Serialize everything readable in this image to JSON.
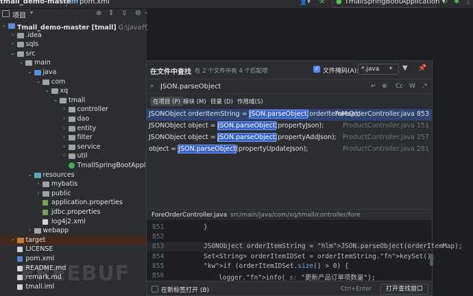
{
  "titlebar": {
    "project_name": "tmall_demo-master",
    "separator": "〉",
    "file_tab_m": "m",
    "file_tab": "pom.xml",
    "run_config": "TmallSpringBootApplication"
  },
  "project_panel": {
    "title": "项目",
    "tree": [
      {
        "label": "Tmall_demo-master",
        "bold_suffix": " [tmall]",
        "path": "G:\\java代码\\系统\\迷你",
        "indent": 0,
        "chev": "v",
        "icon": "folder-blue"
      },
      {
        "label": ".idea",
        "indent": 1,
        "chev": ">",
        "icon": "folder"
      },
      {
        "label": "sqls",
        "indent": 1,
        "chev": ">",
        "icon": "folder"
      },
      {
        "label": "src",
        "indent": 1,
        "chev": "v",
        "icon": "folder"
      },
      {
        "label": "main",
        "indent": 2,
        "chev": "v",
        "icon": "folder"
      },
      {
        "label": "java",
        "indent": 3,
        "chev": "v",
        "icon": "folder-blue"
      },
      {
        "label": "com",
        "indent": 4,
        "chev": "v",
        "icon": "folder"
      },
      {
        "label": "xq",
        "indent": 5,
        "chev": "v",
        "icon": "folder"
      },
      {
        "label": "tmall",
        "indent": 6,
        "chev": "v",
        "icon": "folder"
      },
      {
        "label": "controller",
        "indent": 7,
        "chev": ">",
        "icon": "folder"
      },
      {
        "label": "dao",
        "indent": 7,
        "chev": ">",
        "icon": "folder"
      },
      {
        "label": "entity",
        "indent": 7,
        "chev": ">",
        "icon": "folder"
      },
      {
        "label": "filter",
        "indent": 7,
        "chev": ">",
        "icon": "folder"
      },
      {
        "label": "service",
        "indent": 7,
        "chev": ">",
        "icon": "folder"
      },
      {
        "label": "util",
        "indent": 7,
        "chev": ">",
        "icon": "folder"
      },
      {
        "label": "TmallSpringBootApplicat",
        "indent": 7,
        "chev": "",
        "icon": "file-spring"
      },
      {
        "label": "resources",
        "indent": 3,
        "chev": "v",
        "icon": "folder-teal"
      },
      {
        "label": "mybatis",
        "indent": 4,
        "chev": ">",
        "icon": "folder"
      },
      {
        "label": "public",
        "indent": 4,
        "chev": ">",
        "icon": "folder"
      },
      {
        "label": "application.properties",
        "indent": 4,
        "chev": "",
        "icon": "file-props"
      },
      {
        "label": "jdbc.properties",
        "indent": 4,
        "chev": "",
        "icon": "file-props"
      },
      {
        "label": "log4j2.xml",
        "indent": 4,
        "chev": "",
        "icon": "file"
      },
      {
        "label": "webapp",
        "indent": 3,
        "chev": ">",
        "icon": "folder"
      },
      {
        "label": "target",
        "indent": 1,
        "chev": ">",
        "icon": "folder-orange",
        "selected": true
      },
      {
        "label": "LICENSE",
        "indent": 1,
        "chev": "",
        "icon": "file"
      },
      {
        "label": "pom.xml",
        "indent": 1,
        "chev": "",
        "icon": "file-m"
      },
      {
        "label": "README.md",
        "indent": 1,
        "chev": "",
        "icon": "file"
      },
      {
        "label": "remark.md",
        "indent": 1,
        "chev": "",
        "icon": "file"
      },
      {
        "label": "tmall.iml",
        "indent": 1,
        "chev": "",
        "icon": "file"
      }
    ]
  },
  "find_popup": {
    "title": "在文件中查找",
    "match_count": "在 2 个文件中有 4 个匹配项",
    "file_mask_label": "文件掩码(A):",
    "file_mask_value": "*.java",
    "search_value": "JSON.parseObject",
    "options": [
      "Cc",
      "W",
      ".*"
    ],
    "scopes": [
      "在项目 (P)",
      "模块 (M)",
      "目录 (D)",
      "作用域(S)"
    ],
    "results": [
      {
        "before": "JSONObject orderItemString = ",
        "match": "JSON.parseObject",
        "after": "(orderItemMap);",
        "file": "ForeOrderController.java 853",
        "selected": true
      },
      {
        "before": "JSONObject object = ",
        "match": "JSON.parseObject",
        "after": "(propertyJson);",
        "file": "ProductController.java 151"
      },
      {
        "before": "JSONObject object = ",
        "match": "JSON.parseObject",
        "after": "(propertyAddJson);",
        "file": "ProductController.java 257"
      },
      {
        "before": "object = ",
        "match": "JSON.parseObject",
        "after": "(propertyUpdateJson);",
        "file": "ProductController.java 281"
      }
    ],
    "preview_file": "ForeOrderController.java",
    "preview_path": "src/main/java/com/xq/tmall/controller/fore",
    "preview_lines": [
      {
        "num": "851",
        "code": "}"
      },
      {
        "num": "852",
        "code": ""
      },
      {
        "num": "853",
        "code": "JSONObject orderItemString = JSON.parseObject(orderItemMap);"
      },
      {
        "num": "854",
        "code": "Set<String> orderItemIDSet = orderItemString.keySet();"
      },
      {
        "num": "855",
        "code": "if (orderItemIDSet.size() > 0) {"
      },
      {
        "num": "856",
        "code": "logger.info( s: \"更新产品订单项数量\");"
      }
    ],
    "new_tab_label": "在新标签打开 (B)",
    "shortcut": "Ctrl+Enter",
    "open_button": "打开查找窗口"
  },
  "watermark": "FREEBUF"
}
